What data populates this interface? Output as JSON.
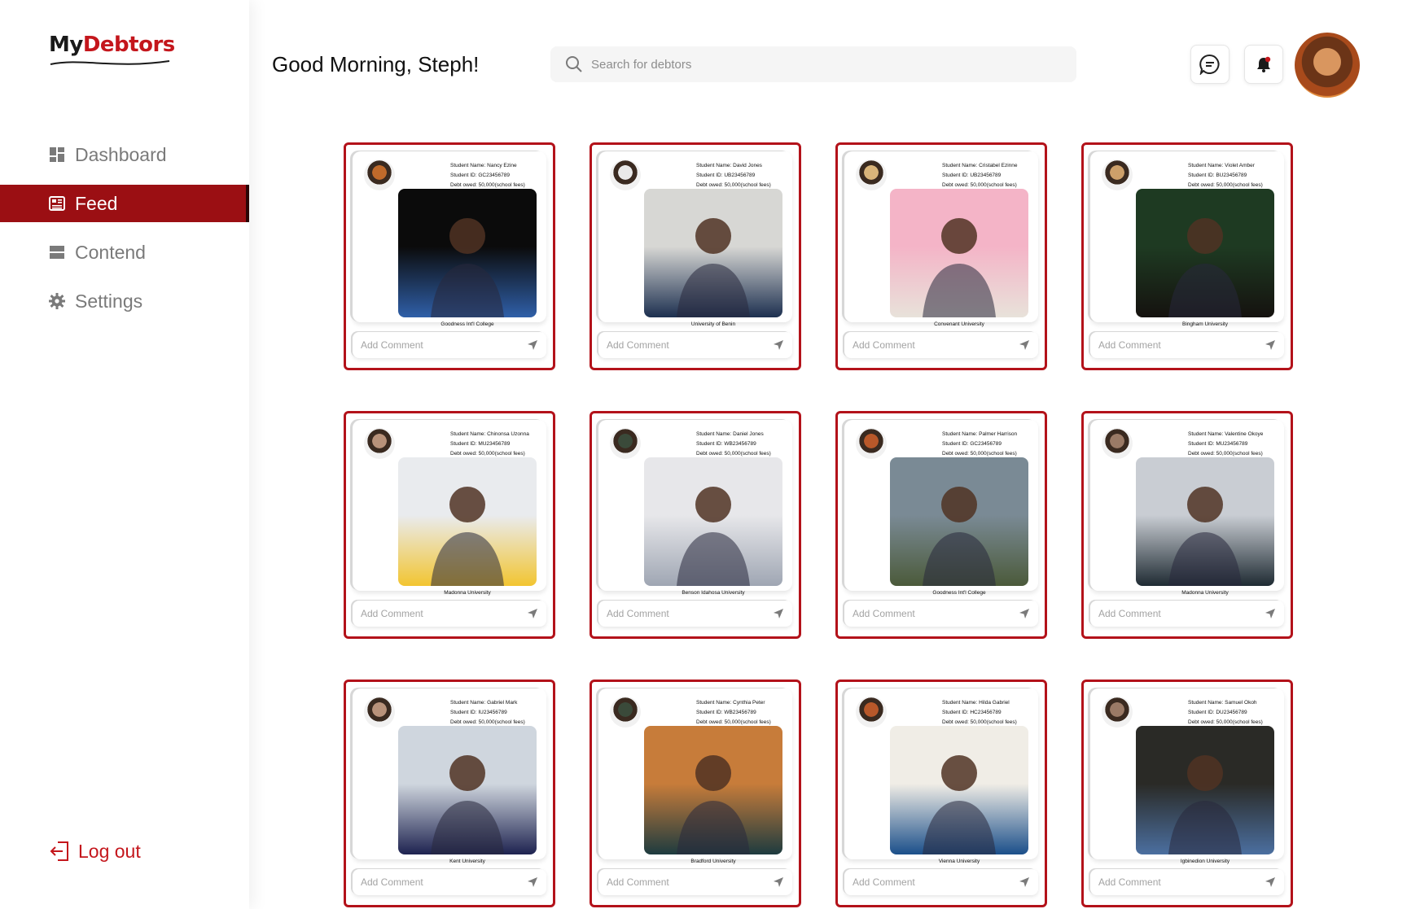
{
  "logo": {
    "part1": "My",
    "part2": "Debtors"
  },
  "sidebar": {
    "items": [
      {
        "label": "Dashboard",
        "icon": "dashboard-icon",
        "active": false
      },
      {
        "label": "Feed",
        "icon": "feed-icon",
        "active": true
      },
      {
        "label": "Contend",
        "icon": "contend-icon",
        "active": false
      },
      {
        "label": "Settings",
        "icon": "gear-icon",
        "active": false
      }
    ],
    "logout": "Log out"
  },
  "header": {
    "greeting": "Good Morning, Steph!",
    "search_placeholder": "Search for debtors"
  },
  "colors": {
    "accent": "#9b0f13",
    "card_border": "#b3121a",
    "logout": "#c4161c"
  },
  "comment_placeholder": "Add Comment",
  "cards": [
    {
      "name": "Student Name: Nancy Ezine",
      "id": "Student ID: GC23456789",
      "debt": "Debt owed: 50,000(school fees)",
      "school": "Goodness Int'l College"
    },
    {
      "name": "Student Name: David Jones",
      "id": "Student ID: UB23456789",
      "debt": "Debt owed: 50,000(school fees)",
      "school": "University of Benin"
    },
    {
      "name": "Student Name: Cristabel Ezinne",
      "id": "Student ID: UB23456789",
      "debt": "Debt owed: 50,000(school fees)",
      "school": "Convenant University"
    },
    {
      "name": "Student Name: Violet Amber",
      "id": "Student ID: BU23456789",
      "debt": "Debt owed: 50,000(school fees)",
      "school": "Bingham University"
    },
    {
      "name": "Student Name: Chinonsa Uzonna",
      "id": "Student ID: MU23456789",
      "debt": "Debt owed: 50,000(school fees)",
      "school": "Madonna University"
    },
    {
      "name": "Student Name: Daniel Jones",
      "id": "Student ID: WB23456789",
      "debt": "Debt owed: 50,000(school fees)",
      "school": "Benson Idahosa University"
    },
    {
      "name": "Student Name: Palmer Harrison",
      "id": "Student ID: GC23456789",
      "debt": "Debt owed: 50,000(school fees)",
      "school": "Goodness Int'l College"
    },
    {
      "name": "Student Name: Valentine Okoye",
      "id": "Student ID: MU23456789",
      "debt": "Debt owed: 50,000(school fees)",
      "school": "Madonna University"
    },
    {
      "name": "Student Name: Gabriel Mark",
      "id": "Student ID: IU23456789",
      "debt": "Debt owed: 50,000(school fees)",
      "school": "Kent University"
    },
    {
      "name": "Student Name: Cynthia Peter",
      "id": "Student ID: WB23456789",
      "debt": "Debt owed: 50,000(school fees)",
      "school": "Bradford University"
    },
    {
      "name": "Student Name: Hilda Gabriel",
      "id": "Student ID: HC23456789",
      "debt": "Debt owed: 50,000(school fees)",
      "school": "Vienna University"
    },
    {
      "name": "Student Name: Samuel Okoh",
      "id": "Student ID: DU23456789",
      "debt": "Debt owed: 50,000(school fees)",
      "school": "Igbinedion University"
    }
  ]
}
